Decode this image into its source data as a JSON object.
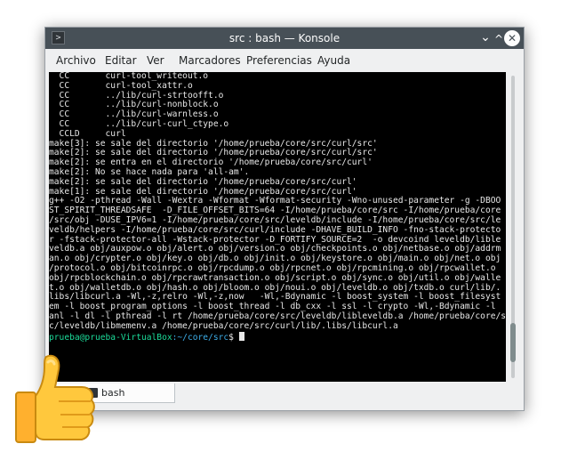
{
  "window": {
    "title": "src : bash — Konsole",
    "app_icon": "terminal-icon",
    "controls": {
      "menu_chevron": "⌄",
      "minimize": "^",
      "close": "✕"
    }
  },
  "menubar": {
    "items": [
      "Archivo",
      "Editar",
      "Ver",
      "Marcadores",
      "Preferencias",
      "Ayuda"
    ]
  },
  "terminal": {
    "lines": [
      "  CC       curl-tool_writeout.o",
      "  CC       curl-tool_xattr.o",
      "  CC       ../lib/curl-strtoofft.o",
      "  CC       ../lib/curl-nonblock.o",
      "  CC       ../lib/curl-warnless.o",
      "  CC       ../lib/curl-curl_ctype.o",
      "  CCLD     curl",
      "make[3]: se sale del directorio '/home/prueba/core/src/curl/src'",
      "make[2]: se sale del directorio '/home/prueba/core/src/curl/src'",
      "make[2]: se entra en el directorio '/home/prueba/core/src/curl'",
      "make[2]: No se hace nada para 'all-am'.",
      "make[2]: se sale del directorio '/home/prueba/core/src/curl'",
      "make[1]: se sale del directorio '/home/prueba/core/src/curl'",
      "g++ -O2 -pthread -Wall -Wextra -Wformat -Wformat-security -Wno-unused-parameter -g -DBOO",
      "ST_SPIRIT_THREADSAFE  -D_FILE_OFFSET_BITS=64 -I/home/prueba/core/src -I/home/prueba/core",
      "/src/obj -DUSE_IPV6=1 -I/home/prueba/core/src/leveldb/include -I/home/prueba/core/src/le",
      "veldb/helpers -I/home/prueba/core/src/curl/include -DHAVE_BUILD_INFO -fno-stack-protecto",
      "r -fstack-protector-all -Wstack-protector -D_FORTIFY_SOURCE=2  -o devcoind leveldb/lible",
      "veldb.a obj/auxpow.o obj/alert.o obj/version.o obj/checkpoints.o obj/netbase.o obj/addrm",
      "an.o obj/crypter.o obj/key.o obj/db.o obj/init.o obj/keystore.o obj/main.o obj/net.o obj",
      "/protocol.o obj/bitcoinrpc.o obj/rpcdump.o obj/rpcnet.o obj/rpcmining.o obj/rpcwallet.o",
      "obj/rpcblockchain.o obj/rpcrawtransaction.o obj/script.o obj/sync.o obj/util.o obj/walle",
      "t.o obj/walletdb.o obj/hash.o obj/bloom.o obj/noui.o obj/leveldb.o obj/txdb.o curl/lib/.",
      "libs/libcurl.a -Wl,-z,relro -Wl,-z,now   -Wl,-Bdynamic -l boost_system -l boost_filesyst",
      "em -l boost_program_options -l boost_thread -l db_cxx -l ssl -l crypto -Wl,-Bdynamic -l",
      "anl -l dl -l pthread -l rt /home/prueba/core/src/leveldb/libleveldb.a /home/prueba/core/sr",
      "c/leveldb/libmemenv.a /home/prueba/core/src/curl/lib/.libs/libcurl.a"
    ],
    "prompt": {
      "user_host": "prueba@prueba-VirtualBox",
      "path": ":~/core/src",
      "symbol": "$ "
    },
    "colors": {
      "background": "#000000",
      "foreground": "#e8e8e8",
      "user_host": "#1cdc9a",
      "path": "#3daee9"
    }
  },
  "scrollbar": {
    "position": 0.94
  },
  "tabs": [
    {
      "label": "bash",
      "icon": "terminal-icon",
      "active": true
    }
  ],
  "overlay": {
    "icon": "thumbs-up-emoji"
  }
}
